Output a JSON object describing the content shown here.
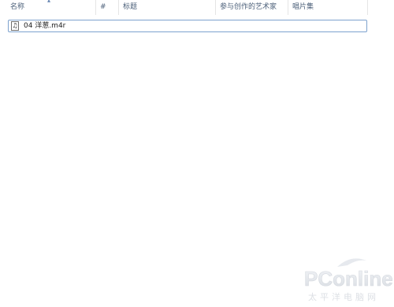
{
  "columns": [
    {
      "id": "name",
      "label": "名称"
    },
    {
      "id": "number",
      "label": "#"
    },
    {
      "id": "title",
      "label": "标题"
    },
    {
      "id": "artist",
      "label": "参与创作的艺术家"
    },
    {
      "id": "album",
      "label": "唱片集"
    }
  ],
  "sort": {
    "column": "name",
    "direction": "ascending",
    "icon": "sort-up-icon"
  },
  "files": [
    {
      "name": "04 洋葱.m4r",
      "icon": "music-file-icon",
      "selected": true
    }
  ],
  "watermark": {
    "brand": "PConline",
    "subtitle": "太平洋电脑网"
  }
}
